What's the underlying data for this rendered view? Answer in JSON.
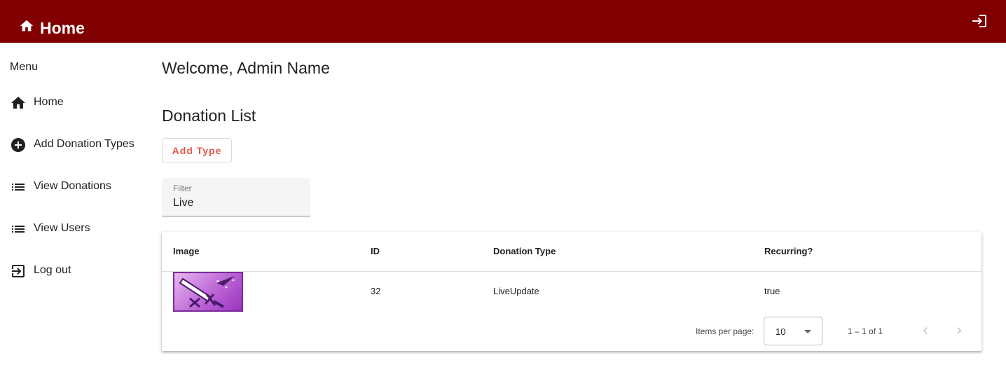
{
  "header": {
    "title": "Home",
    "home_icon": "home-icon",
    "login_icon": "login-icon",
    "bg_color": "#800000"
  },
  "sidebar": {
    "menu_label": "Menu",
    "items": [
      {
        "label": "Home",
        "icon": "home-icon"
      },
      {
        "label": "Add Donation Types",
        "icon": "add-circle-icon"
      },
      {
        "label": "View Donations",
        "icon": "list-icon"
      },
      {
        "label": "View Users",
        "icon": "list-icon"
      },
      {
        "label": "Log out",
        "icon": "logout-icon"
      }
    ]
  },
  "main": {
    "welcome": "Welcome, Admin Name",
    "list_title": "Donation List",
    "add_button": "Add Type",
    "filter": {
      "label": "Filter",
      "value": "Live"
    }
  },
  "table": {
    "columns": [
      "Image",
      "ID",
      "Donation Type",
      "Recurring?"
    ],
    "rows": [
      {
        "image": "sword-thumbnail",
        "id": "32",
        "type": "LiveUpdate",
        "recurring": "true"
      }
    ]
  },
  "paginator": {
    "items_per_page_label": "Items per page:",
    "page_size": "10",
    "range": "1 – 1 of 1"
  }
}
